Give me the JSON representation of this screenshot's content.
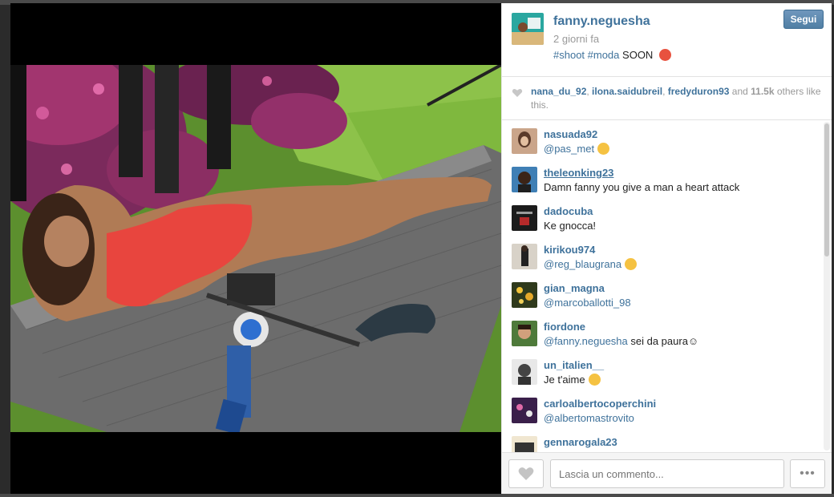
{
  "post": {
    "owner": "fanny.neguesha",
    "time_ago": "2 giorni fa",
    "caption_tags": "#shoot #moda",
    "caption_text": "SOON",
    "caption_emoji": "emoji-tongue",
    "follow_label": "Segui"
  },
  "likes": {
    "user1": "nana_du_92",
    "user2": "ilona.saidubreil",
    "user3": "fredyduron93",
    "and_text": "and",
    "count": "11.5k",
    "suffix": "others like this."
  },
  "comments": [
    {
      "user": "nasuada92",
      "mention": "@pas_met",
      "text": "",
      "emoji": "smirk"
    },
    {
      "user": "theleonking23",
      "mention": "",
      "text": "Damn fanny you give a man a heart attack",
      "emoji": ""
    },
    {
      "user": "dadocuba",
      "mention": "",
      "text": "Ke gnocca!",
      "emoji": ""
    },
    {
      "user": "kirikou974",
      "mention": "@reg_blaugrana",
      "text": "",
      "emoji": "crying"
    },
    {
      "user": "gian_magna",
      "mention": "@marcoballotti_98",
      "text": "",
      "emoji": ""
    },
    {
      "user": "fiordone",
      "mention": "@fanny.neguesha",
      "text": " sei da paura☺",
      "emoji": ""
    },
    {
      "user": "un_italien__",
      "mention": "",
      "text": "Je t'aime",
      "emoji": "heart-eyes"
    },
    {
      "user": "carloalbertocoperchini",
      "mention": "@albertomastrovito",
      "text": "",
      "emoji": ""
    },
    {
      "user": "gennarogala23",
      "mention": "",
      "text": "",
      "emoji": ""
    }
  ],
  "comment_bar": {
    "placeholder": "Lascia un commento...",
    "more_label": "•••"
  },
  "colors": {
    "link": "#3f729b",
    "follow_button": "#517fa4"
  }
}
